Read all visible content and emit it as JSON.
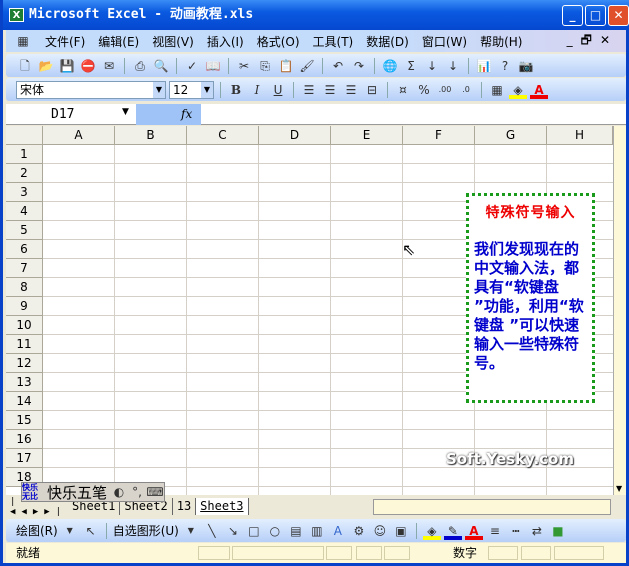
{
  "window": {
    "title": "Microsoft Excel - 动画教程.xls",
    "minimize": "_",
    "maximize": "□",
    "close": "✕"
  },
  "menu": [
    "文件(F)",
    "编辑(E)",
    "视图(V)",
    "插入(I)",
    "格式(O)",
    "工具(T)",
    "数据(D)",
    "窗口(W)",
    "帮助(H)"
  ],
  "menu_controls": {
    "minimize": "_",
    "restore": "🗗",
    "close": "✕"
  },
  "standard_toolbar": [
    "new-icon",
    "open-icon",
    "save-icon",
    "permission-icon",
    "email-icon",
    "print-icon",
    "print-preview-icon",
    "spelling-icon",
    "research-icon",
    "cut-icon",
    "copy-icon",
    "paste-icon",
    "format-painter-icon",
    "undo-icon",
    "redo-icon",
    "hyperlink-icon",
    "autosum-icon",
    "sort-ascending-icon",
    "sort-descending-icon",
    "chart-wizard-icon",
    "help-icon",
    "camera-icon"
  ],
  "formatting": {
    "font": "宋体",
    "size": "12",
    "bold": "B",
    "italic": "I",
    "underline": "U",
    "percent": "%",
    "fill_color": "#ffff00",
    "font_color": "#e00000"
  },
  "formula_bar": {
    "name_box": "D17",
    "fx": "fx",
    "value": ""
  },
  "columns": [
    "A",
    "B",
    "C",
    "D",
    "E",
    "F",
    "G",
    "H"
  ],
  "rows": [
    "1",
    "2",
    "3",
    "4",
    "5",
    "6",
    "7",
    "8",
    "9",
    "10",
    "11",
    "12",
    "13",
    "14",
    "15",
    "16",
    "17",
    "18"
  ],
  "textbox": {
    "title": "特殊符号输入",
    "body": "我们发现现在的中文输入法，都具有“软键盘 ”功能，利用“软键盘 ”可以快速输入一些特殊符号。",
    "border_color": "#1a9a1a",
    "title_color": "#e00000",
    "body_color": "#0000cc"
  },
  "watermark": "Soft.Yesky.com",
  "ime": {
    "logo": "快乐无比",
    "name": "快乐五笔"
  },
  "sheet_tabs": [
    "Sheet1",
    "Sheet2",
    "13",
    "Sheet3"
  ],
  "active_sheet": "Sheet3",
  "drawing_toolbar": {
    "draw": "绘图(R)",
    "autoshapes": "自选图形(U)"
  },
  "status": {
    "ready": "就绪",
    "num": "数字"
  }
}
